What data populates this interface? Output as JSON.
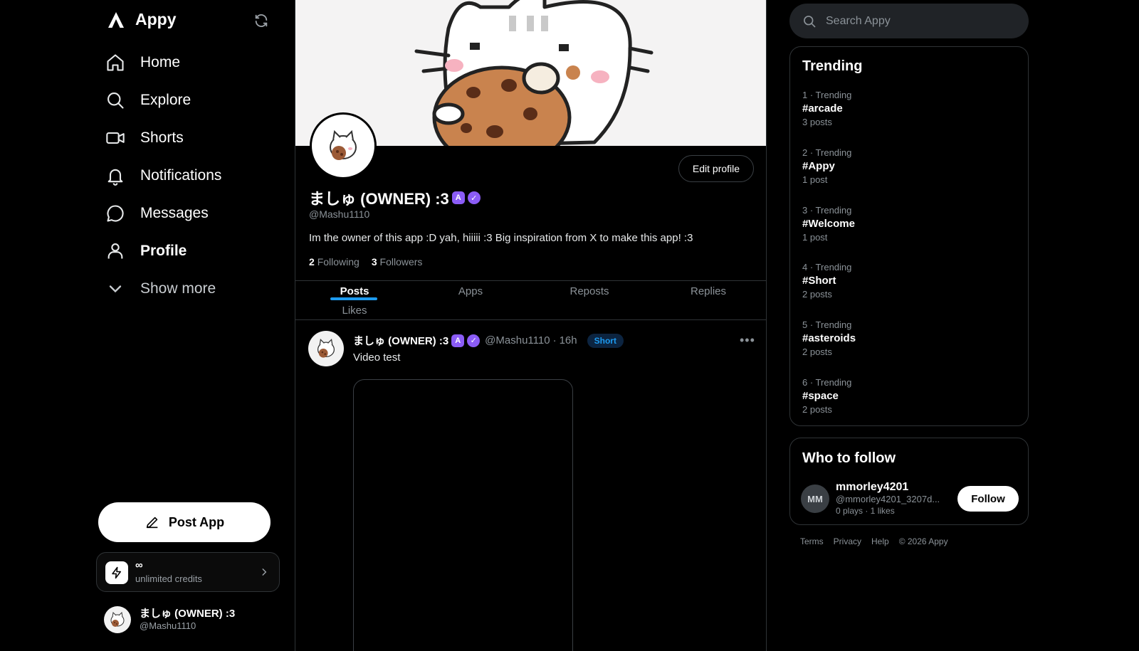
{
  "app": {
    "name": "Appy"
  },
  "sidebar": {
    "nav": [
      {
        "label": "Home",
        "icon": "home-icon"
      },
      {
        "label": "Explore",
        "icon": "search-icon"
      },
      {
        "label": "Shorts",
        "icon": "video-icon"
      },
      {
        "label": "Notifications",
        "icon": "bell-icon"
      },
      {
        "label": "Messages",
        "icon": "chat-icon"
      },
      {
        "label": "Profile",
        "icon": "user-icon",
        "active": true
      },
      {
        "label": "Show more",
        "icon": "chevron-down-icon"
      }
    ],
    "post_button": "Post App",
    "credits": {
      "amount": "∞",
      "label": "unlimited credits"
    },
    "account": {
      "name": "ましゅ (OWNER) :3",
      "handle": "@Mashu1110"
    }
  },
  "profile": {
    "edit_button": "Edit profile",
    "display_name": "ましゅ (OWNER) :3",
    "badge_a": "A",
    "badge_verified": "✓",
    "handle": "@Mashu1110",
    "bio": "Im the owner of this app :D yah, hiiiii :3 Big inspiration from X to make this app! :3",
    "following_count": "2",
    "following_label": "Following",
    "followers_count": "3",
    "followers_label": "Followers",
    "tabs": [
      "Posts",
      "Apps",
      "Reposts",
      "Replies",
      "Likes"
    ],
    "active_tab": "Posts"
  },
  "post": {
    "author": "ましゅ (OWNER) :3",
    "handle": "@Mashu1110",
    "time": "16h",
    "separator": "·",
    "badge": "Short",
    "text": "Video test",
    "more": "•••"
  },
  "right": {
    "search_placeholder": "Search Appy",
    "trending_title": "Trending",
    "trending": [
      {
        "meta": "1 · Trending",
        "tag": "#arcade",
        "count": "3 posts"
      },
      {
        "meta": "2 · Trending",
        "tag": "#Appy",
        "count": "1 post"
      },
      {
        "meta": "3 · Trending",
        "tag": "#Welcome",
        "count": "1 post"
      },
      {
        "meta": "4 · Trending",
        "tag": "#Short",
        "count": "2 posts"
      },
      {
        "meta": "5 · Trending",
        "tag": "#asteroids",
        "count": "2 posts"
      },
      {
        "meta": "6 · Trending",
        "tag": "#space",
        "count": "2 posts"
      }
    ],
    "who_title": "Who to follow",
    "who": {
      "initials": "MM",
      "username": "mmorley4201",
      "handle": "@mmorley4201_3207d...",
      "stats": "0 plays · 1 likes",
      "button": "Follow"
    },
    "footer": [
      "Terms",
      "Privacy",
      "Help",
      "© 2026 Appy"
    ]
  },
  "colors": {
    "accent": "#1d9bf0",
    "badge": "#8b5cf6",
    "background": "#000000"
  }
}
